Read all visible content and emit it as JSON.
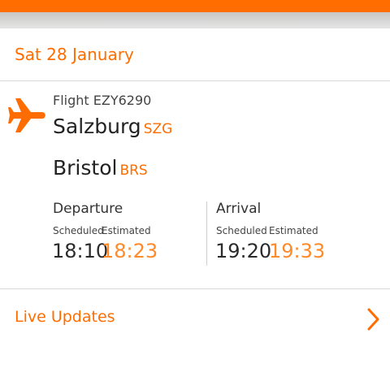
{
  "header": {
    "accent_color": "#ff6d00"
  },
  "date_header": "Sat 28 January",
  "flight": {
    "number_label": "Flight EZY6290",
    "origin": {
      "city": "Salzburg",
      "code": "SZG"
    },
    "destination": {
      "city": "Bristol",
      "code": "BRS"
    },
    "icon": "airplane-icon"
  },
  "departure": {
    "title": "Departure",
    "scheduled_label": "Scheduled",
    "estimated_label": "Estimated",
    "scheduled_time": "18:10",
    "estimated_time": "18:23"
  },
  "arrival": {
    "title": "Arrival",
    "scheduled_label": "Scheduled",
    "estimated_label": "Estimated",
    "scheduled_time": "19:20",
    "estimated_time": "19:33"
  },
  "live_updates": {
    "label": "Live Updates",
    "icon": "chevron-right-icon"
  }
}
